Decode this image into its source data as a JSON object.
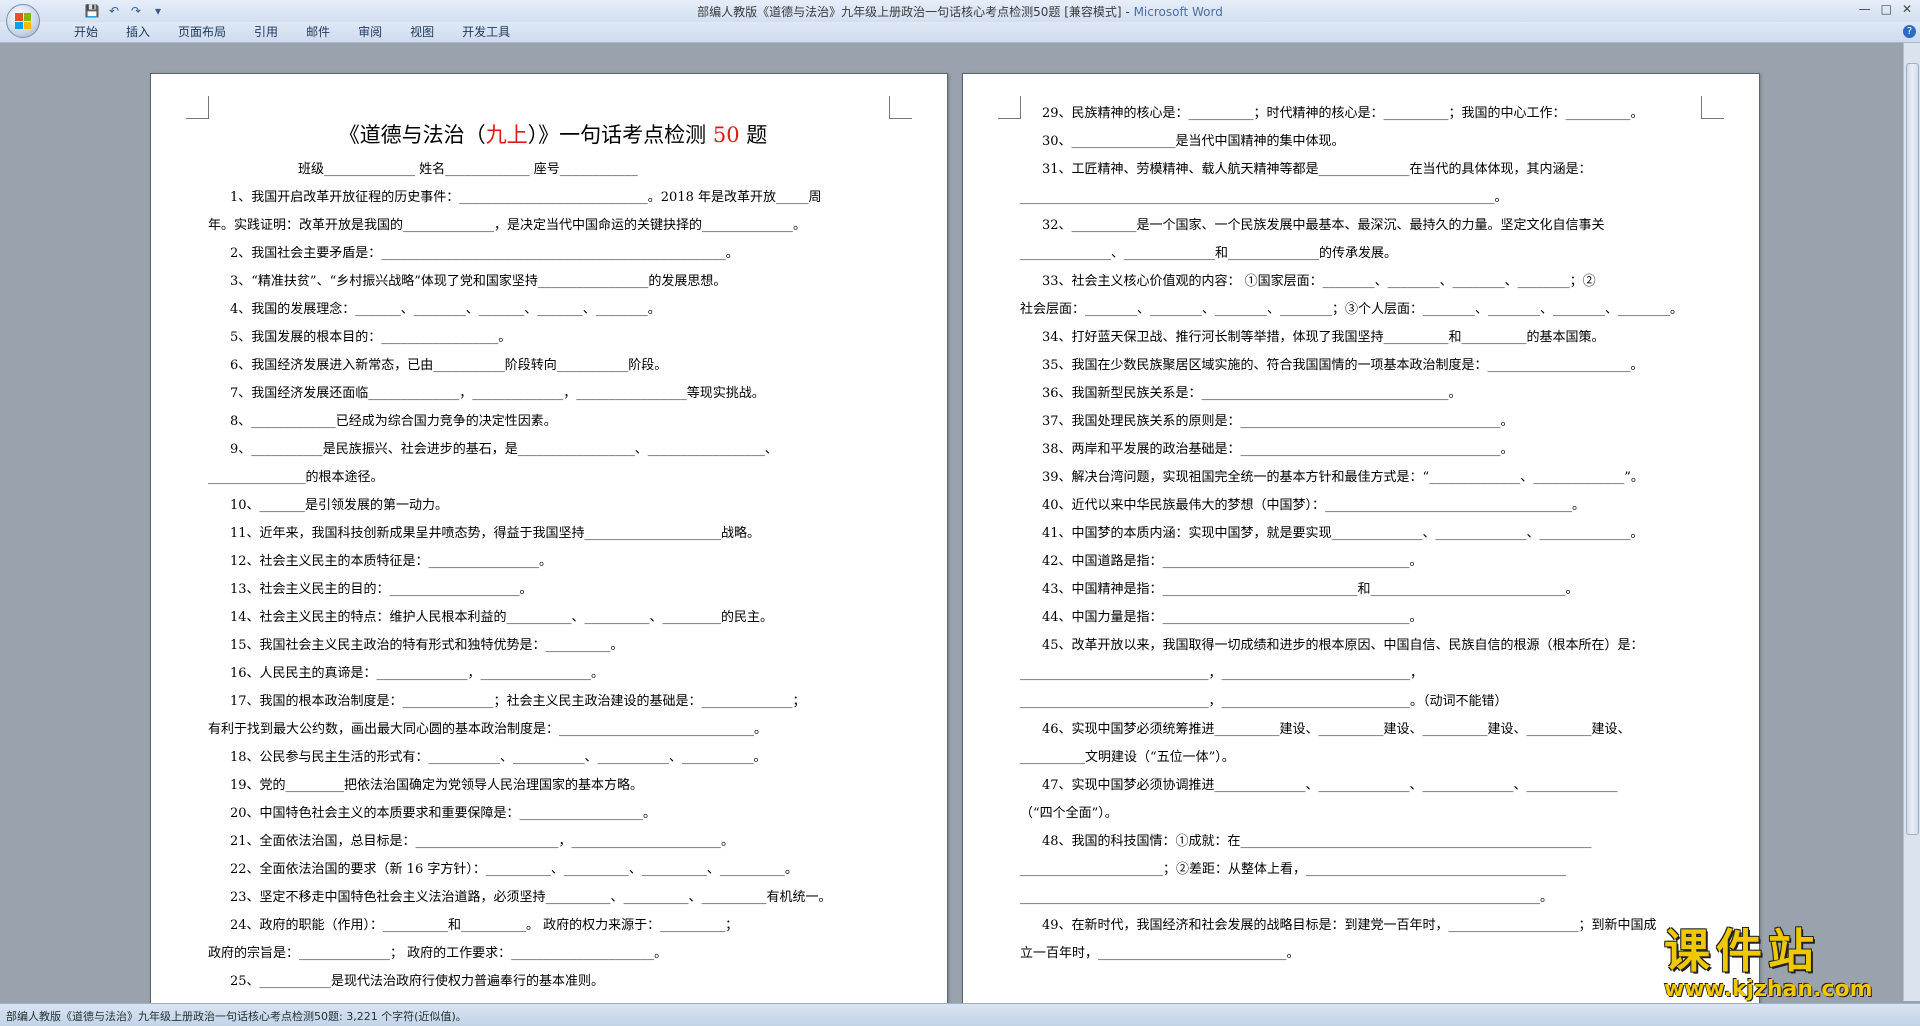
{
  "window": {
    "title_doc": "部编人教版《道德与法治》九年级上册政治一句话核心考点检测50题 [兼容模式] - ",
    "title_app": "Microsoft Word"
  },
  "ribbon": {
    "tabs": [
      "开始",
      "插入",
      "页面布局",
      "引用",
      "邮件",
      "审阅",
      "视图",
      "开发工具"
    ]
  },
  "status": "部编人教版《道德与法治》九年级上册政治一句话核心考点检测50题: 3,221 个字符(近似值)。",
  "watermark": {
    "cn": "课件站",
    "en": "www.kjzhan.com"
  },
  "left_page": {
    "title_pre": "《道德与法治（",
    "title_red": "九上",
    "title_mid": "）》一句话考点检测 ",
    "title_num": "50",
    "title_post": " 题",
    "header_line": "班级______________  姓名_____________    座号____________",
    "lines": [
      "1、我国开启改革开放征程的历史事件：_____________________________。2018 年是改革开放_____周",
      "年。实践证明：改革开放是我国的______________，是决定当代中国命运的关键抉择的______________。",
      "2、我国社会主要矛盾是：_____________________________________________________。",
      "3、“精准扶贫”、“乡村振兴战略”体现了党和国家坚持_________________的发展思想。",
      "4、我国的发展理念：_______、________、_______、_______、________。",
      "5、我国发展的根本目的：__________________。",
      "6、我国经济发展进入新常态，已由___________阶段转向___________阶段。",
      "7、我国经济发展还面临______________，______________，_________________等现实挑战。",
      "8、_____________已经成为综合国力竞争的决定性因素。",
      "9、___________是民族振兴、社会进步的基石，是__________________、__________________、",
      "_______________的根本途径。",
      "10、_______是引领发展的第一动力。",
      "11、近年来，我国科技创新成果呈井喷态势，得益于我国坚持_____________________战略。",
      "12、社会主义民主的本质特征是：_________________。",
      "13、社会主义民主的目的：____________________。",
      "14、社会主义民主的特点：维护人民根本利益的__________、__________、_________的民主。",
      "15、我国社会主义民主政治的特有形式和独特优势是：__________。",
      "16、人民民主的真谛是：______________，_________________。",
      "17、我国的根本政治制度是：______________；社会主义民主政治建设的基础是：______________；",
      "有利于找到最大公约数，画出最大同心圆的基本政治制度是：______________________________。",
      "18、公民参与民主生活的形式有：___________、___________、___________、___________。",
      "19、党的_________把依法治国确定为党领导人民治理国家的基本方略。",
      "20、中国特色社会主义的本质要求和重要保障是：___________________。",
      "21、全面依法治国，总目标是：______________________，_______________________。",
      "22、全面依法治国的要求（新 16 字方针）：__________、__________、__________、__________。",
      "23、坚定不移走中国特色社会主义法治道路，必须坚持__________、__________、__________有机统一。",
      "24、政府的职能（作用）：__________和__________。 政府的权力来源于：__________；",
      "    政府的宗旨是：______________；        政府的工作要求：______________________。",
      "25、___________是现代法治政府行使权力普遍奉行的基本准则。"
    ]
  },
  "right_page": {
    "lines": [
      "29、民族精神的核心是：__________；时代精神的核心是：__________；我国的中心工作：__________。",
      "30、________________是当代中国精神的集中体现。",
      "31、工匠精神、劳模精神、载人航天精神等都是______________在当代的具体体现，其内涵是：",
      "_________________________________________________________________________。",
      "32、__________是一个国家、一个民族发展中最基本、最深沉、最持久的力量。坚定文化自信事关",
      "______________、______________和______________的传承发展。",
      "33、社会主义核心价值观的内容：  ①国家层面：________、________、________、________；②",
      "社会层面：________、________、________、________；③个人层面：________、________、________、________。",
      "34、打好蓝天保卫战、推行河长制等举措，体现了我国坚持__________和__________的基本国策。",
      "35、我国在少数民族聚居区域实施的、符合我国国情的一项基本政治制度是：______________________。",
      "36、我国新型民族关系是：______________________________________。",
      "37、我国处理民族关系的原则是：________________________________________。",
      "38、两岸和平发展的政治基础是：________________________________________。",
      "39、解决台湾问题，实现祖国完全统一的基本方针和最佳方式是：“______________、______________”。",
      "40、近代以来中华民族最伟大的梦想（中国梦）：______________________________________。",
      "41、中国梦的本质内涵：实现中国梦，就是要实现______________、______________、______________。",
      "42、中国道路是指：______________________________________。",
      "43、中国精神是指：______________________________和______________________________。",
      "44、中国力量是指：______________________________________。",
      "45、改革开放以来，我国取得一切成绩和进步的根本原因、中国自信、民族自信的根源（根本所在）是：",
      "_____________________________，_____________________________，",
      "_____________________________，_____________________________。（动词不能错）",
      "46、实现中国梦必须统筹推进__________建设、__________建设、__________建设、__________建设、",
      "__________文明建设（“五位一体”）。",
      "47、实现中国梦必须协调推进______________、______________、______________、______________",
      "（“四个全面”）。",
      "48、我国的科技国情：①成就：在______________________________________________________",
      "______________________；②差距：从整体上看，________________________________________",
      "________________________________________________________________________________。",
      "49、在新时代，我国经济和社会发展的战略目标是：到建党一百年时，____________________；到新中国成",
      "立一百年时，_____________________________。"
    ]
  }
}
